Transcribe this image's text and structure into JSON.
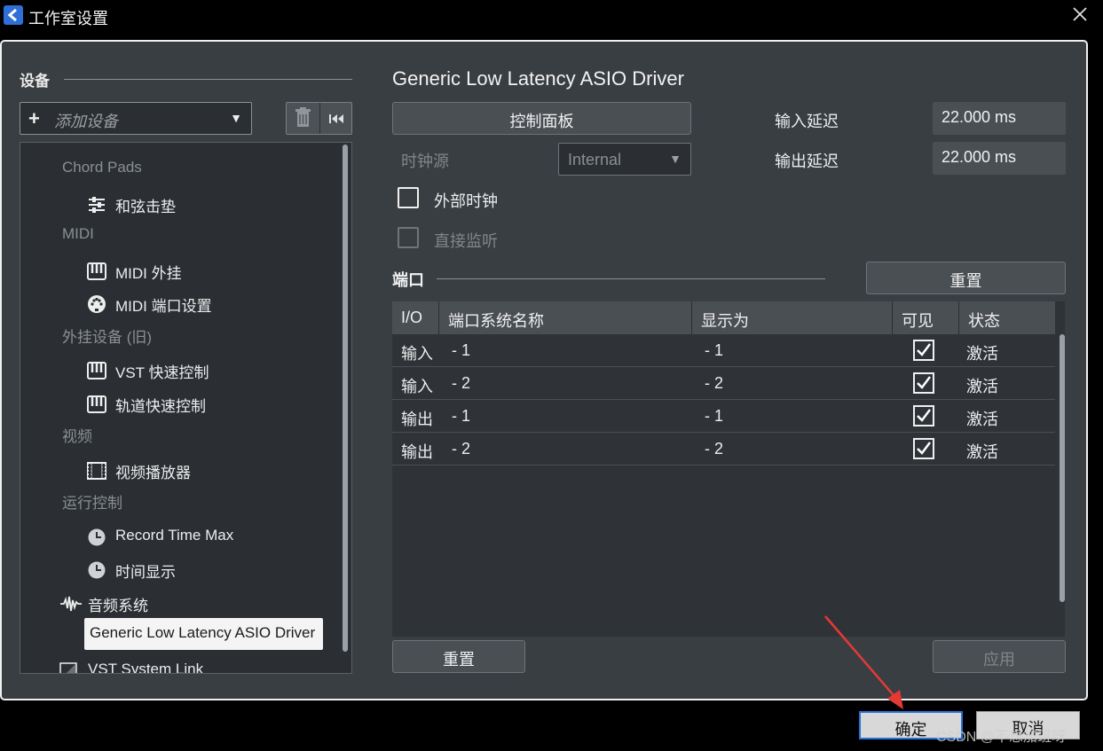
{
  "window": {
    "title": "工作室设置"
  },
  "left": {
    "section_title": "设备",
    "add_device_label": "添加设备",
    "tree": [
      {
        "type": "category",
        "label": "Chord Pads"
      },
      {
        "type": "child",
        "label": "和弦击垫",
        "icon": "chord-pads-icon"
      },
      {
        "type": "category",
        "label": "MIDI"
      },
      {
        "type": "child",
        "label": "MIDI 外挂",
        "icon": "midi-keyboard-icon"
      },
      {
        "type": "child",
        "label": "MIDI 端口设置",
        "icon": "midi-port-icon"
      },
      {
        "type": "category",
        "label": "外挂设备 (旧)"
      },
      {
        "type": "child",
        "label": "VST 快速控制",
        "icon": "midi-keyboard-icon"
      },
      {
        "type": "child",
        "label": "轨道快速控制",
        "icon": "midi-keyboard-icon"
      },
      {
        "type": "category",
        "label": "视频"
      },
      {
        "type": "child",
        "label": "视频播放器",
        "icon": "film-icon"
      },
      {
        "type": "category",
        "label": "运行控制"
      },
      {
        "type": "child",
        "label": "Record Time Max",
        "icon": "clock-icon"
      },
      {
        "type": "child",
        "label": "时间显示",
        "icon": "clock-icon"
      },
      {
        "type": "parent",
        "label": "音频系统",
        "icon": "waveform-icon"
      },
      {
        "type": "selected",
        "label": "Generic Low Latency ASIO Driver"
      },
      {
        "type": "parent",
        "label": "VST System Link",
        "icon": "checkbox-icon"
      }
    ]
  },
  "right": {
    "driver_title": "Generic Low Latency ASIO Driver",
    "control_panel_label": "控制面板",
    "input_latency_label": "输入延迟",
    "input_latency_value": "22.000 ms",
    "output_latency_label": "输出延迟",
    "output_latency_value": "22.000 ms",
    "clock_source_label": "时钟源",
    "clock_source_value": "Internal",
    "external_clock_label": "外部时钟",
    "direct_monitor_label": "直接监听",
    "ports_title": "端口",
    "reset_label": "重置",
    "columns": [
      "I/O",
      "端口系统名称",
      "显示为",
      "可见",
      "状态"
    ],
    "rows": [
      {
        "io": "输入",
        "system_name": "- 1",
        "display_as": "- 1",
        "visible": true,
        "status": "激活"
      },
      {
        "io": "输入",
        "system_name": "- 2",
        "display_as": "- 2",
        "visible": true,
        "status": "激活"
      },
      {
        "io": "输出",
        "system_name": "- 1",
        "display_as": "- 1",
        "visible": true,
        "status": "激活"
      },
      {
        "io": "输出",
        "system_name": "- 2",
        "display_as": "- 2",
        "visible": true,
        "status": "激活"
      }
    ],
    "bottom_reset_label": "重置",
    "apply_label": "应用"
  },
  "footer": {
    "ok_label": "确定",
    "cancel_label": "取消",
    "watermark": "CSDN @不想加班呀"
  },
  "colors": {
    "panel": "#393e42",
    "accent": "#2a72d6",
    "annotation_arrow": "#e53935"
  }
}
